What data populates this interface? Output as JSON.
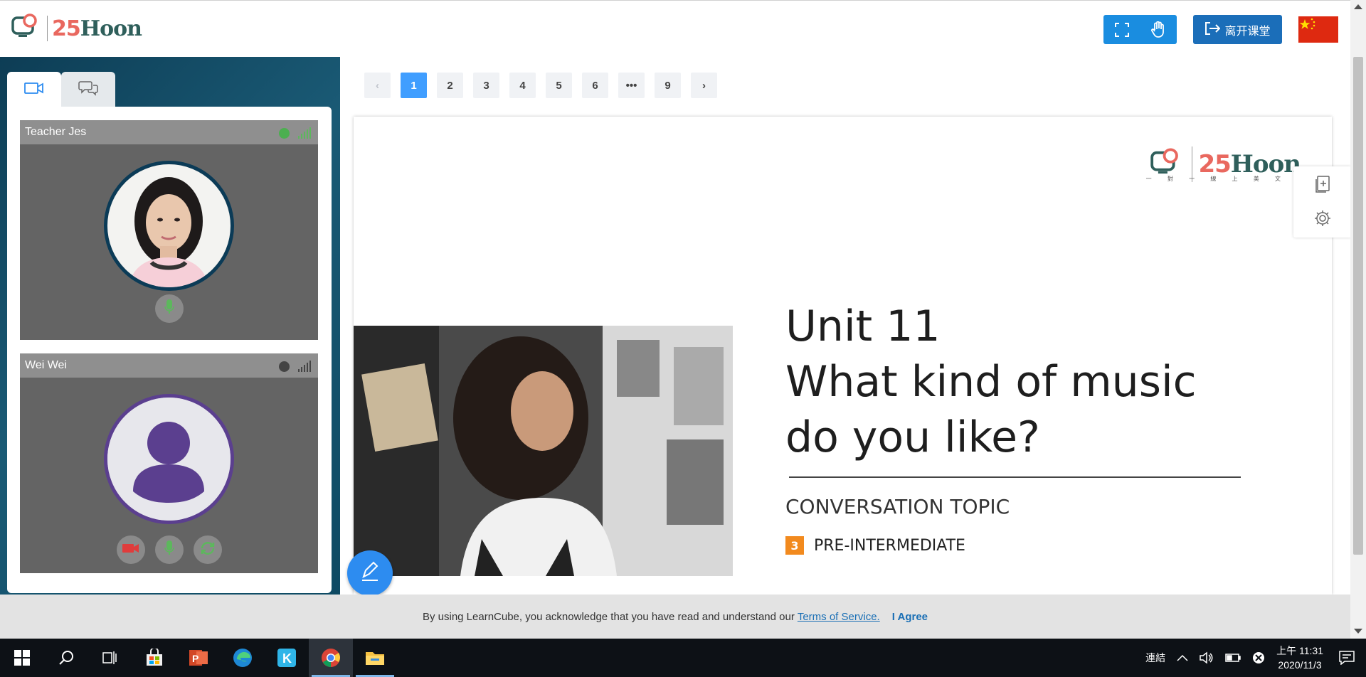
{
  "header": {
    "logo_number": "25",
    "logo_word": "Hoon",
    "fullscreen_icon": "fullscreen-icon",
    "raise_hand_icon": "hand-icon",
    "leave_button": "离开课堂",
    "language_flag": "china-flag"
  },
  "left_panel": {
    "tabs": [
      {
        "icon": "video-camera-icon",
        "active": true
      },
      {
        "icon": "chat-icon",
        "active": false
      }
    ],
    "participants": [
      {
        "name": "Teacher Jes",
        "status_color": "#4caf50",
        "signal_color": "#5cb85c"
      },
      {
        "name": "Wei Wei",
        "status_color": "#444444",
        "signal_color": "#444444"
      }
    ]
  },
  "pagination": {
    "prev": "‹",
    "pages": [
      "1",
      "2",
      "3",
      "4",
      "5",
      "6",
      "•••",
      "9"
    ],
    "next": "›",
    "current": "1"
  },
  "slide": {
    "logo_number": "25",
    "logo_word": "Hoon",
    "logo_subtitle": "一 對 一 線 上 美 文",
    "title_line1": "Unit 11",
    "title_line2": "What kind of music",
    "title_line3": "do you like?",
    "topic": "CONVERSATION TOPIC",
    "level_number": "3",
    "level_label": "PRE-INTERMEDIATE"
  },
  "side_tools": [
    "add-page-icon",
    "gear-icon"
  ],
  "cookie_bar": {
    "text": "By using LearnCube, you acknowledge that you have read and understand our",
    "link": "Terms of Service.",
    "agree": "I Agree"
  },
  "taskbar": {
    "apps": [
      "windows-start-icon",
      "search-icon",
      "task-view-icon",
      "store-icon",
      "powerpoint-icon",
      "edge-icon",
      "k-app-icon",
      "chrome-icon",
      "file-explorer-icon"
    ],
    "network": "連結",
    "time": "上午 11:31",
    "date": "2020/11/3"
  },
  "colors": {
    "accent": "#409eff",
    "header_btn": "#1a8de0",
    "leave_btn": "#1b6eb9",
    "taskbar": "#0d1116"
  }
}
